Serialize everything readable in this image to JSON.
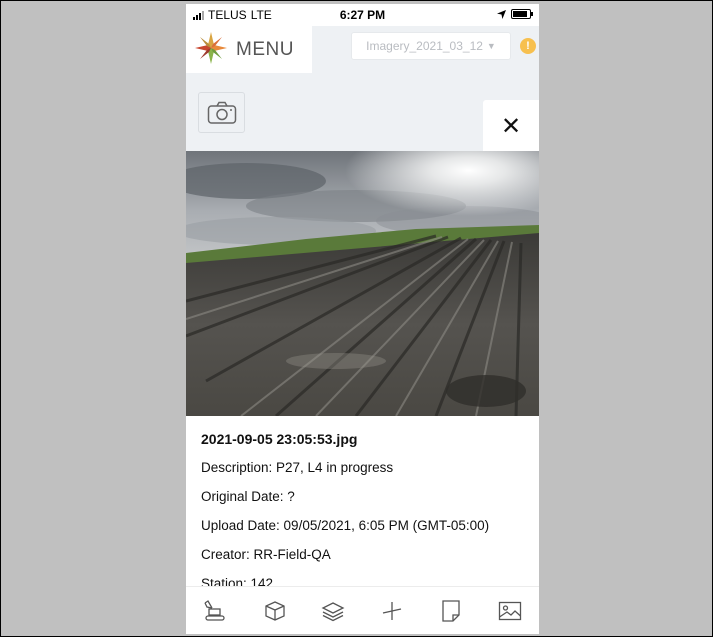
{
  "status_bar": {
    "carrier": "TELUS",
    "network": "LTE",
    "time": "6:27 PM"
  },
  "header": {
    "menu_label": "MENU",
    "imagery_selected": "Imagery_2021_03_12",
    "warning_icon_text": "!"
  },
  "viewer": {
    "close_label": "✕"
  },
  "photo_info": {
    "filename": "2021-09-05 23:05:53.jpg",
    "description": "Description: P27, L4 in progress",
    "original_date": "Original Date: ?",
    "upload_date": "Upload Date: 09/05/2021, 6:05 PM (GMT-05:00)",
    "creator": "Creator: RR-Field-QA",
    "station": "Station: 142"
  },
  "toolbar": {
    "icons": [
      "excavator-icon",
      "cube-icon",
      "layers-icon",
      "measure-icon",
      "document-icon",
      "image-icon"
    ]
  },
  "colors": {
    "frame_background": "#c0c0c0",
    "app_background": "#eef1f4",
    "warning": "#f7c04f",
    "icon": "#555555"
  }
}
